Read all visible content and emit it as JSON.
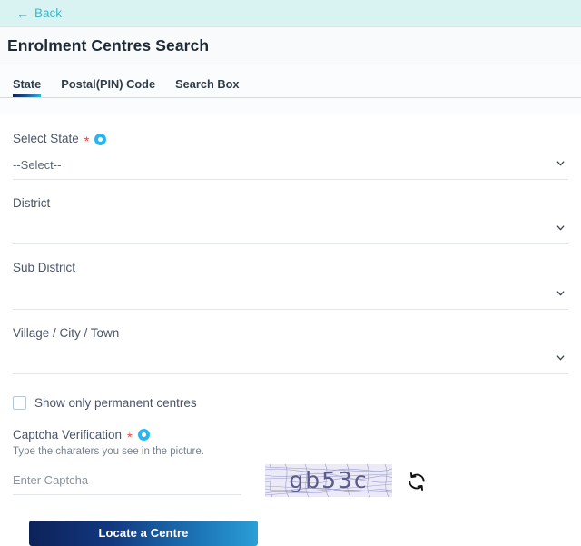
{
  "topbar": {
    "back_label": "Back",
    "back_arrow": "←",
    "accent_color": "#3fb8c4",
    "background_color": "#d9f2f2"
  },
  "header": {
    "title": "Enrolment Centres Search"
  },
  "tabs": [
    {
      "label": "State",
      "active": true
    },
    {
      "label": "Postal(PIN) Code",
      "active": false
    },
    {
      "label": "Search Box",
      "active": false
    }
  ],
  "form": {
    "fields": [
      {
        "label": "Select State",
        "required": true,
        "has_info_icon": true,
        "value": "--Select--",
        "icon": "chevron-down-icon"
      },
      {
        "label": "District",
        "required": false,
        "has_info_icon": false,
        "value": "",
        "icon": "chevron-down-icon"
      },
      {
        "label": "Sub District",
        "required": false,
        "has_info_icon": false,
        "value": "",
        "icon": "chevron-down-icon"
      },
      {
        "label": "Village / City / Town",
        "required": false,
        "has_info_icon": false,
        "value": "",
        "icon": "chevron-down-icon"
      }
    ],
    "checkbox": {
      "label": "Show only permanent centres",
      "checked": false
    },
    "captcha": {
      "label": "Captcha Verification",
      "required": true,
      "has_info_icon": true,
      "hint": "Type the charaters you see in the picture.",
      "input_value": "",
      "input_placeholder": "Enter Captcha",
      "image_text": "gb53c",
      "refresh_icon": "refresh-icon"
    },
    "submit": {
      "label": "Locate a Centre",
      "gradient_start": "#0d2259",
      "gradient_end": "#2a9fd6"
    }
  },
  "colors": {
    "required_star": "#e53e3e",
    "info_icon": "#29b6ef",
    "label_text": "#4a5568",
    "title_text": "#1f2a37"
  }
}
